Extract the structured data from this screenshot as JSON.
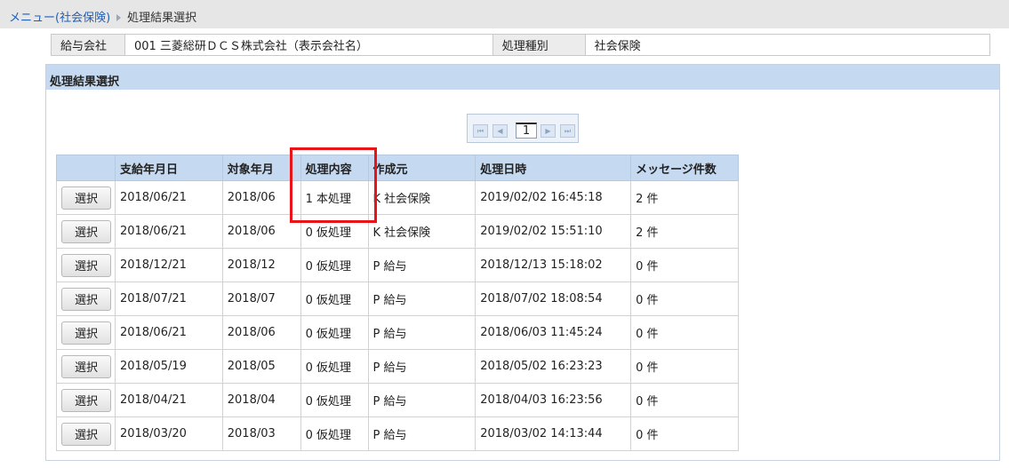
{
  "breadcrumb": {
    "menu_link": "メニュー(社会保険)",
    "current": "処理結果選択"
  },
  "info": {
    "company_label": "給与会社",
    "company_value": "001 三菱総研ＤＣＳ株式会社（表示会社名）",
    "type_label": "処理種別",
    "type_value": "社会保険"
  },
  "panel": {
    "title": "処理結果選択"
  },
  "pager": {
    "first": "⏮",
    "prev": "◀",
    "page": "1",
    "next": "▶",
    "last": "⏭"
  },
  "table": {
    "select_label": "選択",
    "headers": [
      "",
      "支給年月日",
      "対象年月",
      "処理内容",
      "作成元",
      "処理日時",
      "メッセージ件数"
    ],
    "rows": [
      {
        "pay_date": "2018/06/21",
        "target_month": "2018/06",
        "process": "1 本処理",
        "source": "K 社会保険",
        "datetime": "2019/02/02 16:45:18",
        "messages": "2 件"
      },
      {
        "pay_date": "2018/06/21",
        "target_month": "2018/06",
        "process": "0 仮処理",
        "source": "K 社会保険",
        "datetime": "2019/02/02 15:51:10",
        "messages": "2 件"
      },
      {
        "pay_date": "2018/12/21",
        "target_month": "2018/12",
        "process": "0 仮処理",
        "source": "P 給与",
        "datetime": "2018/12/13 15:18:02",
        "messages": "0 件"
      },
      {
        "pay_date": "2018/07/21",
        "target_month": "2018/07",
        "process": "0 仮処理",
        "source": "P 給与",
        "datetime": "2018/07/02 18:08:54",
        "messages": "0 件"
      },
      {
        "pay_date": "2018/06/21",
        "target_month": "2018/06",
        "process": "0 仮処理",
        "source": "P 給与",
        "datetime": "2018/06/03 11:45:24",
        "messages": "0 件"
      },
      {
        "pay_date": "2018/05/19",
        "target_month": "2018/05",
        "process": "0 仮処理",
        "source": "P 給与",
        "datetime": "2018/05/02 16:23:23",
        "messages": "0 件"
      },
      {
        "pay_date": "2018/04/21",
        "target_month": "2018/04",
        "process": "0 仮処理",
        "source": "P 給与",
        "datetime": "2018/04/03 16:23:56",
        "messages": "0 件"
      },
      {
        "pay_date": "2018/03/20",
        "target_month": "2018/03",
        "process": "0 仮処理",
        "source": "P 給与",
        "datetime": "2018/03/02 14:13:44",
        "messages": "0 件"
      }
    ]
  },
  "colors": {
    "header_bg": "#c5d9f1",
    "highlight": "#e8141a",
    "link": "#1f5fb8"
  }
}
